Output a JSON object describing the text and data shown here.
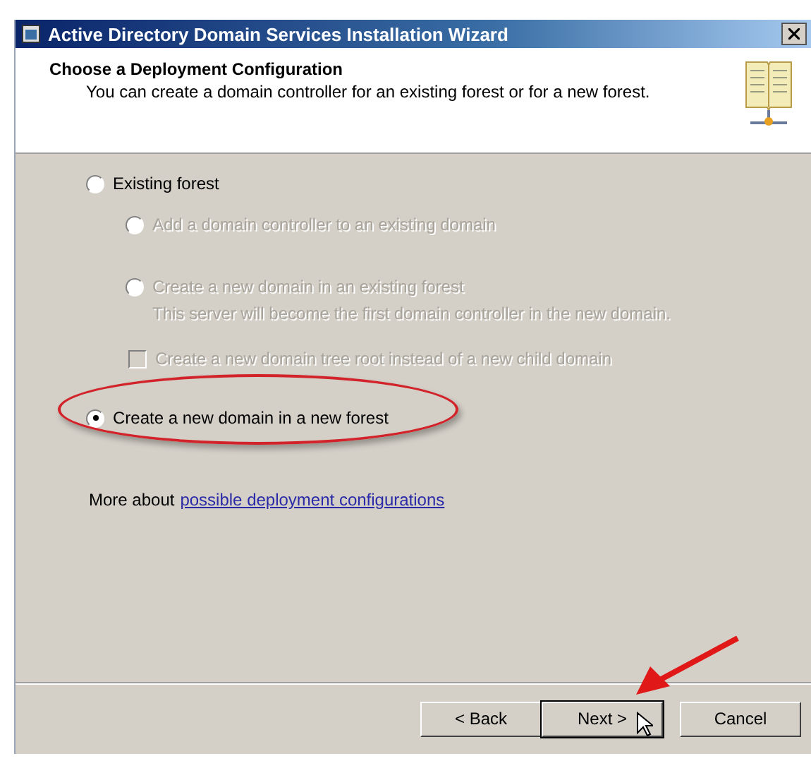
{
  "window": {
    "title": "Active Directory Domain Services Installation Wizard"
  },
  "header": {
    "title": "Choose a Deployment Configuration",
    "subtitle": "You can create a domain controller for an existing forest or for a new forest."
  },
  "options": [
    {
      "kind": "radio",
      "label": "Existing forest",
      "selected": false,
      "disabled": false,
      "highlighted": false,
      "children": [
        {
          "kind": "radio",
          "label": "Add a domain controller to an existing domain",
          "selected": false,
          "disabled": true
        },
        {
          "kind": "radio",
          "label": "Create a new domain in an existing forest",
          "description": "This server will become the first domain controller in the new domain.",
          "selected": false,
          "disabled": true,
          "children": [
            {
              "kind": "checkbox",
              "label": "Create a new domain tree root instead of a new child domain",
              "checked": false,
              "disabled": true
            }
          ]
        }
      ]
    },
    {
      "kind": "radio",
      "label": "Create a new domain in a new forest",
      "selected": true,
      "disabled": false,
      "highlighted": true
    }
  ],
  "more": {
    "text": "More about",
    "link": "possible deployment configurations"
  },
  "buttons": [
    {
      "label": "< Back",
      "default": false,
      "annotated": false
    },
    {
      "label": "Next >",
      "default": true,
      "annotated": true
    },
    {
      "label": "Cancel",
      "default": false,
      "annotated": false
    }
  ]
}
